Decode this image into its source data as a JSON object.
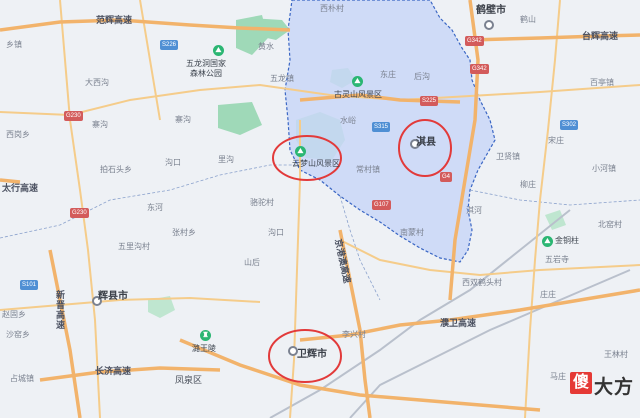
{
  "map": {
    "highways": [
      {
        "id": "hw-fanhui",
        "label": "范辉高速"
      },
      {
        "id": "hw-taihang",
        "label": "太行高速"
      },
      {
        "id": "hw-xinhui",
        "label": "新晋高速"
      },
      {
        "id": "hw-jinghai",
        "label": "京港澳高速"
      },
      {
        "id": "hw-pujiao",
        "label": "濮卫高速"
      },
      {
        "id": "hw-changwei",
        "label": "长济高速"
      },
      {
        "id": "hw-taihui",
        "label": "台辉高速"
      }
    ],
    "road_badges": [
      {
        "id": "g230a",
        "label": "G230",
        "kind": "g"
      },
      {
        "id": "g230b",
        "label": "G230",
        "kind": "g"
      },
      {
        "id": "s315",
        "label": "S315",
        "kind": "s"
      },
      {
        "id": "s226",
        "label": "S226",
        "kind": "s"
      },
      {
        "id": "s302",
        "label": "S302",
        "kind": "s"
      },
      {
        "id": "s101",
        "label": "S101",
        "kind": "s"
      },
      {
        "id": "g107",
        "label": "G107",
        "kind": "g"
      },
      {
        "id": "g4",
        "label": "G4",
        "kind": "g"
      },
      {
        "id": "g342",
        "label": "G342",
        "kind": "g"
      },
      {
        "id": "g342b",
        "label": "G342",
        "kind": "g"
      },
      {
        "id": "s225",
        "label": "S225",
        "kind": "g"
      }
    ],
    "cities": [
      {
        "id": "hebi",
        "label": "鹤壁市"
      },
      {
        "id": "huixian",
        "label": "辉县市"
      },
      {
        "id": "weihui",
        "label": "卫辉市"
      },
      {
        "id": "qixian",
        "label": "淇县"
      }
    ],
    "scenic": [
      {
        "id": "wulongdong",
        "label": "五龙洞国家\n森林公园"
      },
      {
        "id": "guling",
        "label": "古灵山风景区"
      },
      {
        "id": "yunmeng",
        "label": "云梦山风景区"
      },
      {
        "id": "luwang",
        "label": "潞王陵"
      },
      {
        "id": "jinzhu",
        "label": "金铜柱"
      }
    ],
    "places": [
      {
        "id": "p1",
        "label": "黄水"
      },
      {
        "id": "p2",
        "label": "五龙镇"
      },
      {
        "id": "p3",
        "label": "大西沟"
      },
      {
        "id": "p4",
        "label": "乡镇"
      },
      {
        "id": "p5",
        "label": "寨沟"
      },
      {
        "id": "p6",
        "label": "拍石头乡"
      },
      {
        "id": "p7",
        "label": "沟口"
      },
      {
        "id": "p8",
        "label": "里沟"
      },
      {
        "id": "p9",
        "label": "东河"
      },
      {
        "id": "p10",
        "label": "骆驼村"
      },
      {
        "id": "p11",
        "label": "张村乡"
      },
      {
        "id": "p12",
        "label": "五里沟村"
      },
      {
        "id": "p13",
        "label": "山后"
      },
      {
        "id": "p14",
        "label": "沙窑乡"
      },
      {
        "id": "p15",
        "label": "赵固乡"
      },
      {
        "id": "p16",
        "label": "占城镇"
      },
      {
        "id": "p17",
        "label": "凤泉区"
      },
      {
        "id": "p18",
        "label": "李兴村"
      },
      {
        "id": "p19",
        "label": "西双鹤头村"
      },
      {
        "id": "p20",
        "label": "庄庄"
      },
      {
        "id": "p21",
        "label": "王林村"
      },
      {
        "id": "p22",
        "label": "马庄"
      },
      {
        "id": "p23",
        "label": "卫贤镇"
      },
      {
        "id": "p24",
        "label": "宋庄"
      },
      {
        "id": "p25",
        "label": "小河镇"
      },
      {
        "id": "p26",
        "label": "百亭镇"
      },
      {
        "id": "p27",
        "label": "西岗乡"
      },
      {
        "id": "p28",
        "label": "寨沟"
      },
      {
        "id": "p29",
        "label": "西朴村"
      },
      {
        "id": "p30",
        "label": "水峪"
      },
      {
        "id": "p31",
        "label": "淇河"
      },
      {
        "id": "p32",
        "label": "南蒙村"
      },
      {
        "id": "p33",
        "label": "常村镇"
      },
      {
        "id": "p34",
        "label": "东庄"
      },
      {
        "id": "p35",
        "label": "后沟"
      },
      {
        "id": "p36",
        "label": "沟口"
      },
      {
        "id": "p37",
        "label": "柳庄"
      },
      {
        "id": "p38",
        "label": "五岩寺"
      },
      {
        "id": "p39",
        "label": "鹤山"
      },
      {
        "id": "p40",
        "label": "北窑村"
      }
    ],
    "watermark": {
      "box_char": "傻",
      "text": "大方"
    },
    "colors": {
      "background": "#eef1f5",
      "highlight_fill": "#c9d7f7",
      "highlight_border": "#3a66c4",
      "highway": "#f2b36b",
      "national_road": "#f5cc8a",
      "green": "#9fd9b8",
      "circle": "#e23a3a",
      "railway": "#b9c0cc"
    }
  }
}
